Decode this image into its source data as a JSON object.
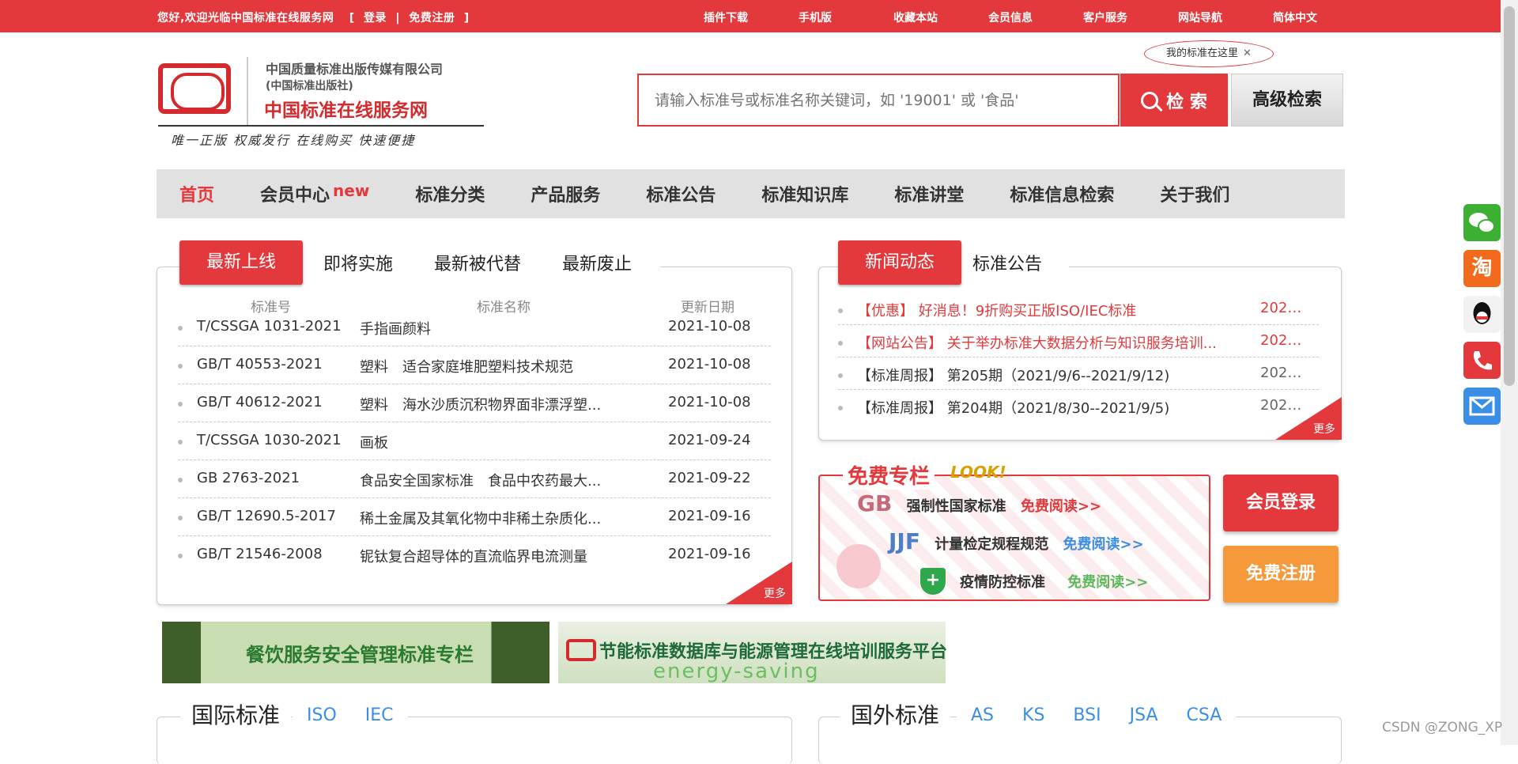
{
  "topbar": {
    "welcome": "您好,欢迎光临中国标准在线服务网",
    "bracket_open": "[",
    "login": "登录",
    "sep": "|",
    "register": "免费注册",
    "bracket_close": "]",
    "links": [
      "插件下载",
      "手机版",
      "收藏本站",
      "会员信息",
      "客户服务",
      "网站导航",
      "简体中文"
    ]
  },
  "logo": {
    "line1": "中国质量标准出版传媒有限公司",
    "line2": "(中国标准出版社)",
    "line3": "中国标准在线服务网",
    "slogan": "唯一正版  权威发行  在线购买  快速便捷"
  },
  "tip": {
    "text": "我的标准在这里",
    "close": "✕"
  },
  "search": {
    "placeholder": "请输入标准号或标准名称关键词，如 '19001' 或 '食品'",
    "button": "检 索",
    "advanced": "高级检索"
  },
  "nav": {
    "items": [
      "首页",
      "会员中心",
      "标准分类",
      "产品服务",
      "标准公告",
      "标准知识库",
      "标准讲堂",
      "标准信息检索",
      "关于我们"
    ],
    "new_badge": "new"
  },
  "latest": {
    "tabs": [
      "最新上线",
      "即将实施",
      "最新被代替",
      "最新废止"
    ],
    "headers": [
      "标准号",
      "标准名称",
      "更新日期"
    ],
    "rows": [
      {
        "code": "T/CSSGA 1031-2021",
        "name": "手指画颜料",
        "date": "2021-10-08"
      },
      {
        "code": "GB/T 40553-2021",
        "name": "塑料　适合家庭堆肥塑料技术规范",
        "date": "2021-10-08"
      },
      {
        "code": "GB/T 40612-2021",
        "name": "塑料　海水沙质沉积物界面非漂浮塑...",
        "date": "2021-10-08"
      },
      {
        "code": "T/CSSGA 1030-2021",
        "name": "画板",
        "date": "2021-09-24"
      },
      {
        "code": "GB 2763-2021",
        "name": "食品安全国家标准　食品中农药最大...",
        "date": "2021-09-22"
      },
      {
        "code": "GB/T 12690.5-2017",
        "name": "稀土金属及其氧化物中非稀土杂质化...",
        "date": "2021-09-16"
      },
      {
        "code": "GB/T 21546-2008",
        "name": "铌钛复合超导体的直流临界电流测量",
        "date": "2021-09-16"
      }
    ],
    "more": "更多"
  },
  "news": {
    "tabs": [
      "新闻动态",
      "标准公告"
    ],
    "rows": [
      {
        "title": "【优惠】 好消息！9折购买正版ISO/IEC标准",
        "date": "2020...",
        "highlight": true
      },
      {
        "title": "【网站公告】 关于举办标准大数据分析与知识服务培训...",
        "date": "2021...",
        "highlight": true
      },
      {
        "title": "【标准周报】 第205期（2021/9/6--2021/9/12)",
        "date": "2021...",
        "highlight": false
      },
      {
        "title": "【标准周报】 第204期（2021/8/30--2021/9/5)",
        "date": "2021...",
        "highlight": false
      }
    ],
    "more": "更多"
  },
  "free": {
    "title": "免费专栏",
    "look": "LOOK!",
    "lines": [
      {
        "badge": "GB",
        "label": "强制性国家标准",
        "action": "免费阅读>>"
      },
      {
        "badge": "JJF",
        "label": "计量检定规程规范",
        "action": "免费阅读>>"
      },
      {
        "badge": "+",
        "label": "疫情防控标准",
        "action": "免费阅读>>"
      }
    ]
  },
  "side_buttons": {
    "login": "会员登录",
    "register": "免费注册"
  },
  "banners": {
    "catering": "餐饮服务安全管理标准专栏",
    "energy_title": "节能标准数据库与能源管理在线培训服务平台",
    "energy_sub": "energy-saving"
  },
  "intl": {
    "title": "国际标准",
    "tabs": [
      "ISO",
      "IEC"
    ]
  },
  "foreign": {
    "title": "国外标准",
    "tabs": [
      "AS",
      "KS",
      "BSI",
      "JSA",
      "CSA"
    ]
  },
  "float_icons": [
    "wechat-icon",
    "taobao-icon",
    "qq-icon",
    "phone-icon",
    "mail-icon"
  ],
  "float_labels": [
    "",
    "淘",
    "",
    "",
    ""
  ],
  "watermark": "CSDN @ZONG_XP",
  "colors": {
    "accent": "#e4393c",
    "link_blue": "#3a8ee6",
    "orange": "#f5993a",
    "nav_bg": "#e1e1e1"
  }
}
